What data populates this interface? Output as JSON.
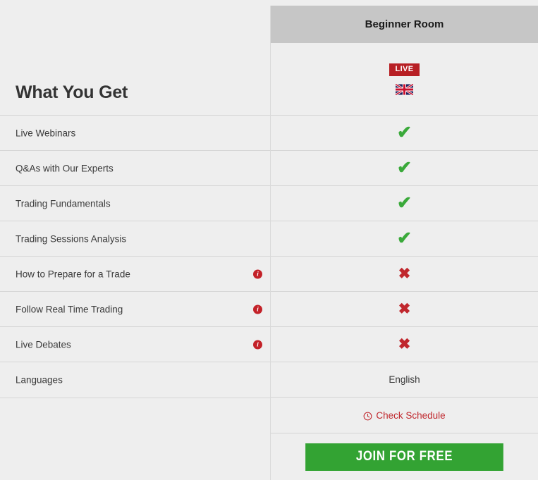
{
  "left": {
    "title": "What You Get",
    "features": [
      {
        "label": "Live Webinars",
        "has_info": false
      },
      {
        "label": "Q&As with Our Experts",
        "has_info": false
      },
      {
        "label": "Trading Fundamentals",
        "has_info": false
      },
      {
        "label": "Trading Sessions Analysis",
        "has_info": false
      },
      {
        "label": "How to Prepare for a Trade",
        "has_info": true
      },
      {
        "label": "Follow Real Time Trading",
        "has_info": true
      },
      {
        "label": "Live Debates",
        "has_info": true
      },
      {
        "label": "Languages",
        "has_info": false
      }
    ],
    "info_icon_glyph": "i"
  },
  "column": {
    "title": "Beginner Room",
    "live_badge": "LIVE",
    "flag_icon": "uk-flag-icon",
    "values": [
      {
        "type": "check",
        "glyph": "✔"
      },
      {
        "type": "check",
        "glyph": "✔"
      },
      {
        "type": "check",
        "glyph": "✔"
      },
      {
        "type": "check",
        "glyph": "✔"
      },
      {
        "type": "cross",
        "glyph": "✖"
      },
      {
        "type": "cross",
        "glyph": "✖"
      },
      {
        "type": "cross",
        "glyph": "✖"
      },
      {
        "type": "text",
        "glyph": "English"
      }
    ],
    "schedule_label": "Check Schedule",
    "cta_label": "Join For Free"
  },
  "colors": {
    "page_background": "#eeeeee",
    "header_background": "#c6c6c6",
    "live_red": "#b71f24",
    "check_green": "#3aa93a",
    "cross_red": "#c0272d",
    "link_red": "#c0272d",
    "cta_green": "#33a333",
    "divider": "#d5d5d5",
    "info_red": "#c32128"
  }
}
